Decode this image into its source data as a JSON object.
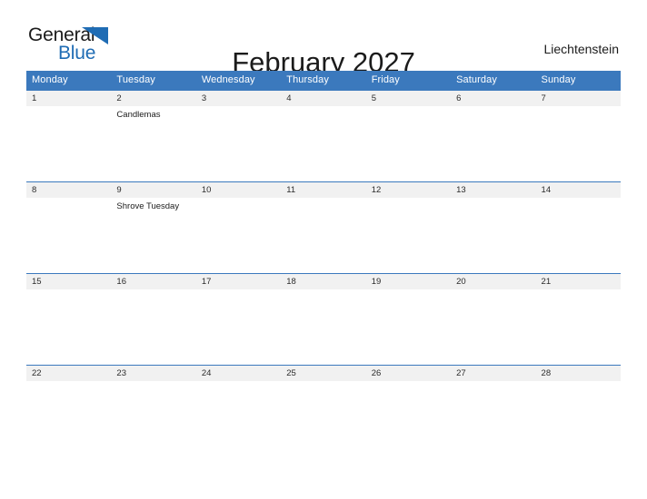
{
  "brand": {
    "word_one": "General",
    "word_two": "Blue",
    "flag_icon": "blue-triangle-flag-icon",
    "accent_color": "#1f6cb4"
  },
  "header": {
    "title": "February 2027",
    "region": "Liechtenstein"
  },
  "calendar": {
    "header_bg": "#3b79bd",
    "header_text_color": "#ffffff",
    "date_band_bg": "#f1f1f1",
    "row_border_color": "#3b79bd",
    "weekday_headers": [
      "Monday",
      "Tuesday",
      "Wednesday",
      "Thursday",
      "Friday",
      "Saturday",
      "Sunday"
    ],
    "weeks": [
      {
        "days": [
          {
            "date": "1",
            "events": []
          },
          {
            "date": "2",
            "events": [
              "Candlemas"
            ]
          },
          {
            "date": "3",
            "events": []
          },
          {
            "date": "4",
            "events": []
          },
          {
            "date": "5",
            "events": []
          },
          {
            "date": "6",
            "events": []
          },
          {
            "date": "7",
            "events": []
          }
        ]
      },
      {
        "days": [
          {
            "date": "8",
            "events": []
          },
          {
            "date": "9",
            "events": [
              "Shrove Tuesday"
            ]
          },
          {
            "date": "10",
            "events": []
          },
          {
            "date": "11",
            "events": []
          },
          {
            "date": "12",
            "events": []
          },
          {
            "date": "13",
            "events": []
          },
          {
            "date": "14",
            "events": []
          }
        ]
      },
      {
        "days": [
          {
            "date": "15",
            "events": []
          },
          {
            "date": "16",
            "events": []
          },
          {
            "date": "17",
            "events": []
          },
          {
            "date": "18",
            "events": []
          },
          {
            "date": "19",
            "events": []
          },
          {
            "date": "20",
            "events": []
          },
          {
            "date": "21",
            "events": []
          }
        ]
      },
      {
        "days": [
          {
            "date": "22",
            "events": []
          },
          {
            "date": "23",
            "events": []
          },
          {
            "date": "24",
            "events": []
          },
          {
            "date": "25",
            "events": []
          },
          {
            "date": "26",
            "events": []
          },
          {
            "date": "27",
            "events": []
          },
          {
            "date": "28",
            "events": []
          }
        ]
      }
    ]
  }
}
